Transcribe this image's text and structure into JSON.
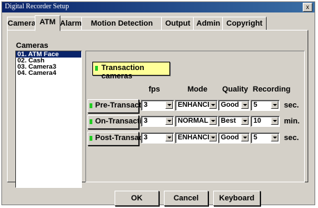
{
  "window": {
    "title": "Digital Recorder Setup",
    "close": "x"
  },
  "tabs": [
    "Camera",
    "ATM",
    "Alarm",
    "Motion Detection",
    "Output",
    "Admin",
    "Copyright"
  ],
  "active_tab": "ATM",
  "cameras": {
    "label": "Cameras",
    "items": [
      "01. ATM Face",
      "02. Cash",
      "03. Camera3",
      "04. Camera4"
    ],
    "selected": "01. ATM Face"
  },
  "transaction_cameras_label": "Transaction cameras",
  "headers": {
    "fps": "fps",
    "mode": "Mode",
    "quality": "Quality",
    "recording": "Recording"
  },
  "rows": [
    {
      "label": "Pre-Transact.",
      "fps": "3",
      "mode": "ENHANCE",
      "quality": "Good",
      "recording": "5",
      "unit": "sec."
    },
    {
      "label": "On-Transaction",
      "fps": "3",
      "mode": "NORMAL",
      "quality": "Best",
      "recording": "10",
      "unit": "min."
    },
    {
      "label": "Post-Transact.",
      "fps": "3",
      "mode": "ENHANCE",
      "quality": "Good",
      "recording": "5",
      "unit": "sec."
    }
  ],
  "buttons": {
    "ok": "OK",
    "cancel": "Cancel",
    "keyboard": "Keyboard"
  },
  "colors": {
    "indicator_led": "#22cc22",
    "transaction_box": "#ffff99",
    "selection": "#0a246a"
  }
}
